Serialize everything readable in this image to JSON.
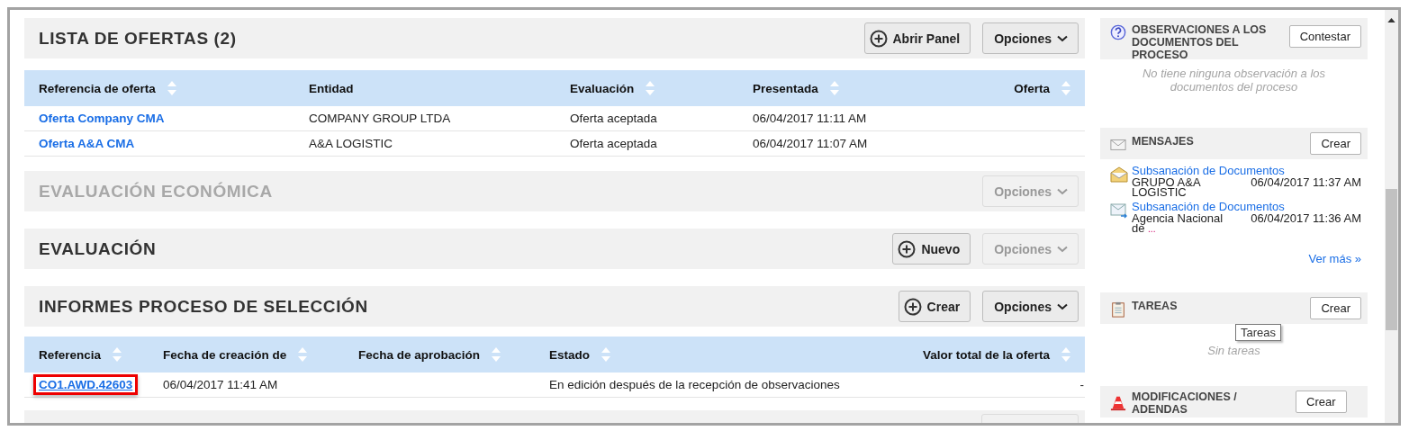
{
  "sections": [
    {
      "title": "LISTA DE OFERTAS (2)",
      "disabled": false,
      "buttons": [
        {
          "label": "Abrir Panel",
          "kind": "add",
          "disabled": false
        },
        {
          "label": "Opciones",
          "kind": "menu",
          "disabled": false
        }
      ],
      "table": {
        "columns": [
          {
            "label": "Referencia de oferta",
            "sortable": true
          },
          {
            "label": "Entidad",
            "sortable": false
          },
          {
            "label": "Evaluación",
            "sortable": true
          },
          {
            "label": "Presentada",
            "sortable": true
          },
          {
            "label": "Oferta",
            "sortable": true
          }
        ],
        "rows": [
          {
            "highlighted": false,
            "cells": [
              "Oferta Company CMA",
              "COMPANY GROUP LTDA",
              "Oferta aceptada",
              "06/04/2017 11:11 AM",
              ""
            ]
          },
          {
            "highlighted": false,
            "cells": [
              "Oferta A&A CMA",
              "A&A LOGISTIC",
              "Oferta aceptada",
              "06/04/2017 11:07 AM",
              ""
            ]
          }
        ]
      }
    },
    {
      "title": "EVALUACIÓN ECONÓMICA",
      "disabled": true,
      "buttons": [
        {
          "label": "Opciones",
          "kind": "menu",
          "disabled": true
        }
      ]
    },
    {
      "title": "EVALUACIÓN",
      "disabled": false,
      "buttons": [
        {
          "label": "Nuevo",
          "kind": "add",
          "disabled": false
        },
        {
          "label": "Opciones",
          "kind": "menu",
          "disabled": true
        }
      ]
    },
    {
      "title": "INFORMES PROCESO DE SELECCIÓN",
      "disabled": false,
      "buttons": [
        {
          "label": "Crear",
          "kind": "add",
          "disabled": false
        },
        {
          "label": "Opciones",
          "kind": "menu",
          "disabled": false
        }
      ],
      "table": {
        "columns": [
          {
            "label": "Referencia",
            "sortable": true
          },
          {
            "label": "Fecha de creación de",
            "sortable": true
          },
          {
            "label": "Fecha de aprobación",
            "sortable": true
          },
          {
            "label": "Estado",
            "sortable": true
          },
          {
            "label": "Valor total de la oferta",
            "sortable": true
          }
        ],
        "rows": [
          {
            "highlighted": true,
            "cells": [
              "CO1.AWD.42603",
              "06/04/2017 11:41 AM",
              "",
              "En edición después de la recepción de observaciones",
              "-"
            ]
          }
        ]
      }
    }
  ],
  "panels": [
    {
      "kind": "observations",
      "title": "OBSERVACIONES A LOS DOCUMENTOS DEL PROCESO",
      "button": "Contestar",
      "empty_text": "No tiene ninguna observación a los documentos del proceso"
    },
    {
      "kind": "messages",
      "title": "MENSAJES",
      "button": "Crear",
      "messages": [
        {
          "kind": "received",
          "subject": "Subsanación de Documentos",
          "sender": "GRUPO A&A LOGISTIC",
          "date": "06/04/2017 11:37 AM"
        },
        {
          "kind": "sent",
          "subject": "Subsanación de Documentos",
          "sender": "Agencia Nacional de",
          "truncated": "...",
          "date": "06/04/2017 11:36 AM"
        }
      ],
      "more_link": "Ver más »"
    },
    {
      "kind": "tasks",
      "title": "TAREAS",
      "button": "Crear",
      "empty_text": "Sin tareas",
      "tooltip": "Tareas"
    },
    {
      "kind": "amendments",
      "title": "MODIFICACIONES / ADENDAS",
      "button": "Crear"
    }
  ]
}
